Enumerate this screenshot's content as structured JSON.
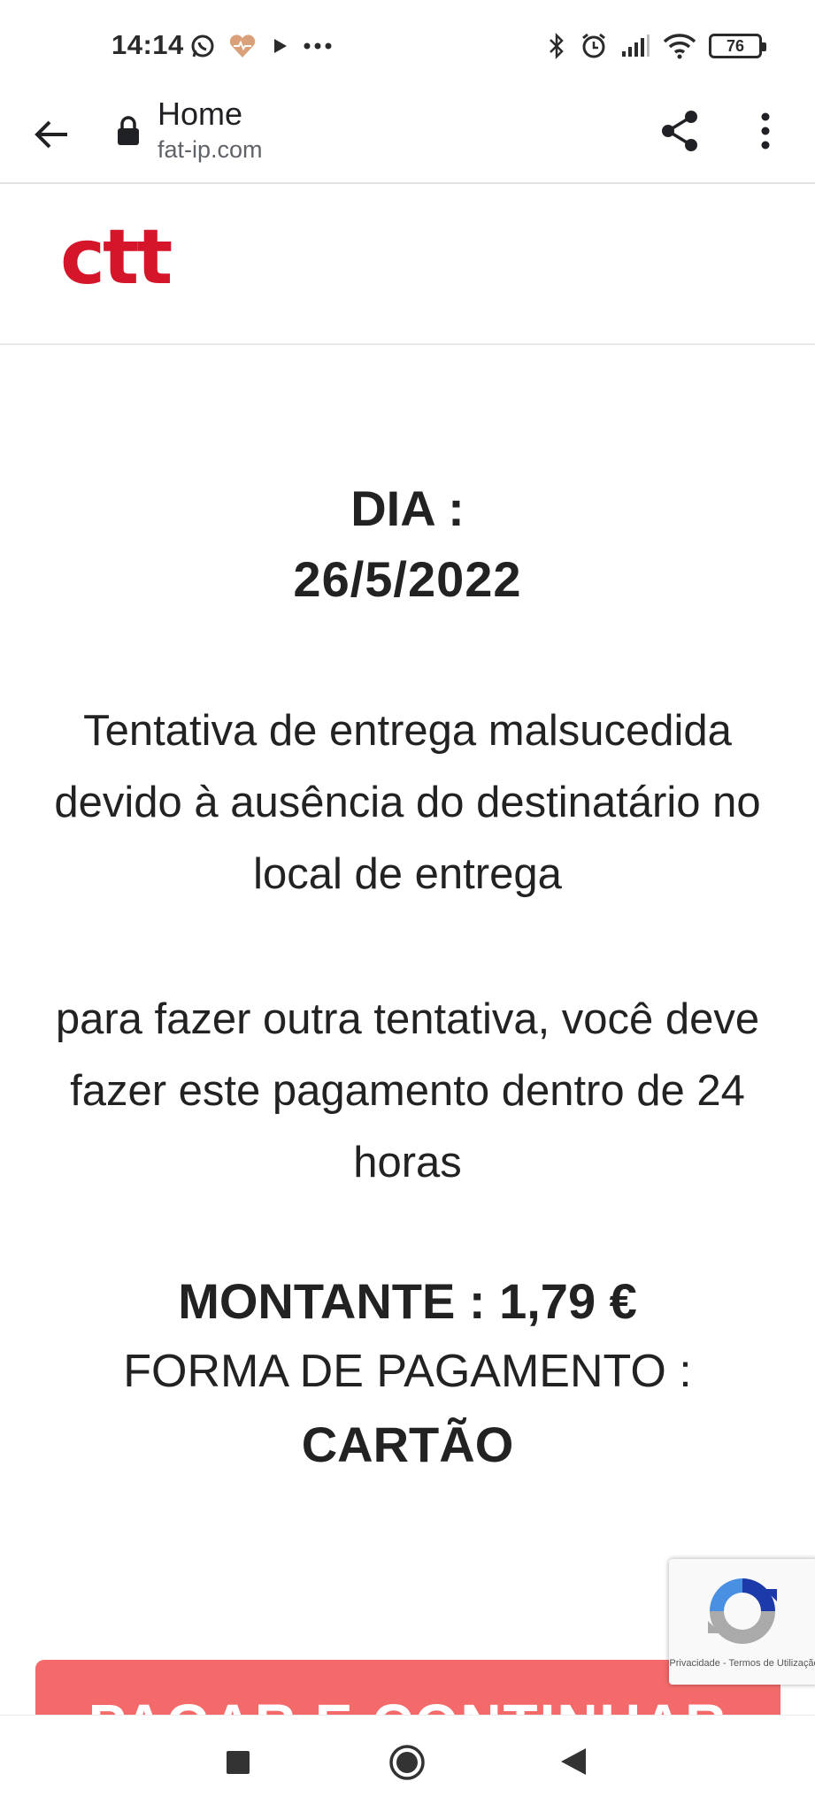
{
  "status_bar": {
    "time": "14:14",
    "battery": "76",
    "icons": [
      "whatsapp-icon",
      "heart-icon",
      "play-icon",
      "more-dots-icon",
      "bluetooth-icon",
      "alarm-icon",
      "signal-icon",
      "wifi-icon",
      "battery-icon"
    ]
  },
  "browser": {
    "page_title": "Home",
    "url": "fat-ip.com",
    "icons": [
      "back-arrow-icon",
      "lock-icon",
      "share-icon",
      "overflow-menu-icon"
    ]
  },
  "site": {
    "logo_text": "ctt",
    "brand_color": "#d5152a"
  },
  "content": {
    "date_label": "DIA :",
    "date_value": "26/5/2022",
    "message1": "Tentativa de entrega malsucedida devido à ausência do destinatário no local de entrega",
    "message2": "para fazer outra tentativa, você deve fazer este pagamento dentro de 24 horas",
    "amount": "MONTANTE : 1,79 €",
    "payment_method_label": "FORMA DE PAGAMENTO :",
    "payment_method_value": "CARTÃO"
  },
  "pay_button": {
    "label": "PAGAR E CONTINUAR",
    "color": "#f46a6a"
  },
  "recaptcha": {
    "links": "Privacidade - Termos de Utilização"
  },
  "nav_bar": {
    "icons": [
      "recent-apps-icon",
      "home-icon",
      "back-icon"
    ]
  }
}
